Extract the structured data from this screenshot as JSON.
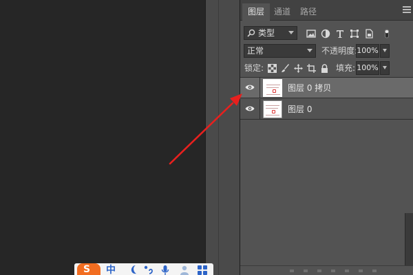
{
  "panel": {
    "tabs": [
      {
        "label": "图层",
        "active": true
      },
      {
        "label": "通道",
        "active": false
      },
      {
        "label": "路径",
        "active": false
      }
    ],
    "filter": {
      "kind_label": "类型",
      "filter_icons": [
        "image-filter-icon",
        "adjustment-filter-icon",
        "type-filter-icon",
        "shape-filter-icon",
        "smart-object-filter-icon",
        "filter-toggle-icon"
      ]
    },
    "blend": {
      "mode": "正常",
      "opacity_label": "不透明度:",
      "opacity_value": "100%"
    },
    "lock": {
      "lock_label": "锁定:",
      "lock_icons": [
        "lock-transparent-icon",
        "lock-image-icon",
        "lock-position-icon",
        "lock-artboard-icon",
        "lock-all-icon"
      ],
      "fill_label": "填充:",
      "fill_value": "100%"
    },
    "layers": [
      {
        "name": "图层 0 拷贝",
        "visible": true,
        "selected": true
      },
      {
        "name": "图层 0",
        "visible": true,
        "selected": false
      }
    ]
  },
  "taskbar": {
    "ime_brand": "S",
    "ime_mode": "中",
    "icons": [
      "moon-icon",
      "punctuation-icon",
      "microphone-icon",
      "user-icon",
      "grid-icon"
    ]
  },
  "colors": {
    "canvas_bg": "#262626",
    "panel_bg": "#535353",
    "selected_layer_bg": "#6a6a6a",
    "arrow": "#e8201e",
    "ime_brand": "#f26d20"
  }
}
